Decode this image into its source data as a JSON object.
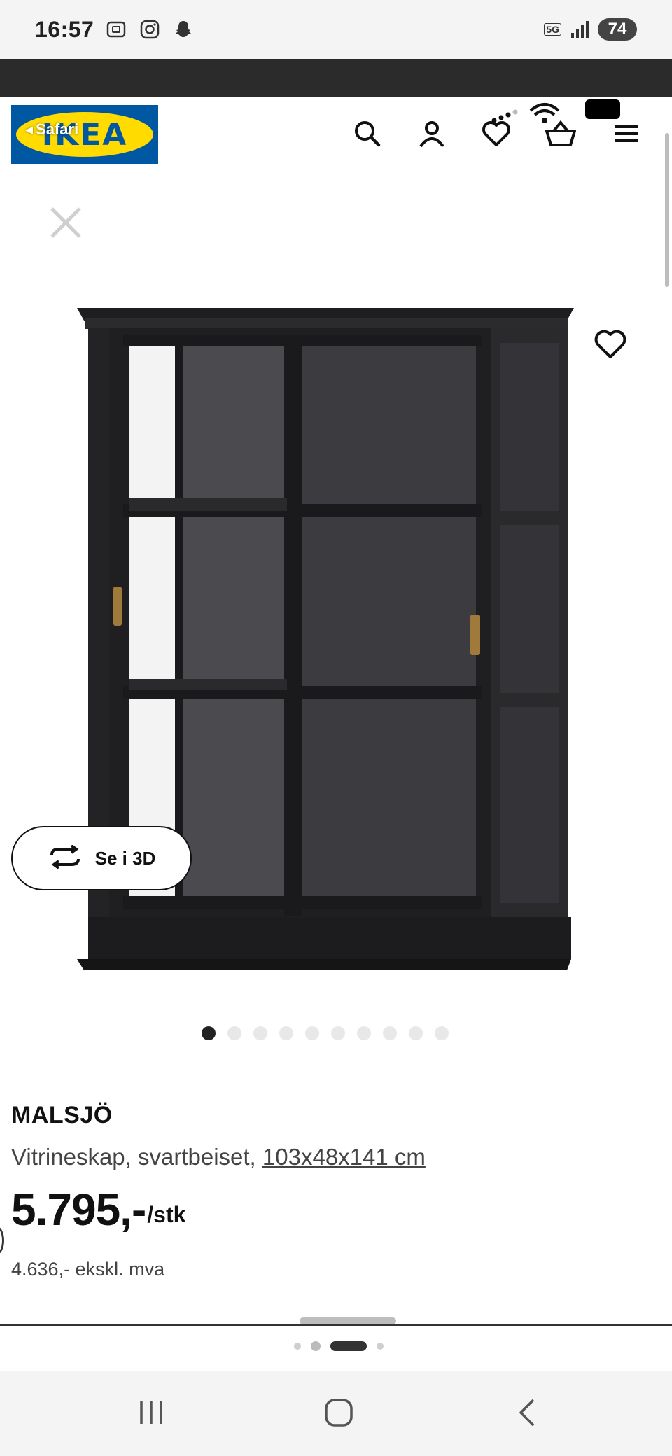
{
  "status_bar": {
    "time": "16:57",
    "network": "5G",
    "battery": "74"
  },
  "header": {
    "logo_text": "IKEA",
    "safari_back_label": "Safari",
    "icons": [
      "search-icon",
      "account-icon",
      "favorites-icon",
      "cart-icon",
      "menu-icon"
    ]
  },
  "gallery": {
    "see_3d_label": "Se i 3D",
    "image_count": 10,
    "active_index": 0
  },
  "product": {
    "name": "MALSJÖ",
    "description": "Vitrineskap, svartbeiset, ",
    "dimensions": "103x48x141 cm",
    "price": "5.795,-",
    "price_unit": "/stk",
    "price_ex_vat": "4.636,- ekskl. mva"
  },
  "colors": {
    "ikea_blue": "#0058a3",
    "ikea_yellow": "#ffdb00",
    "cabinet": "#2a2a2d"
  }
}
